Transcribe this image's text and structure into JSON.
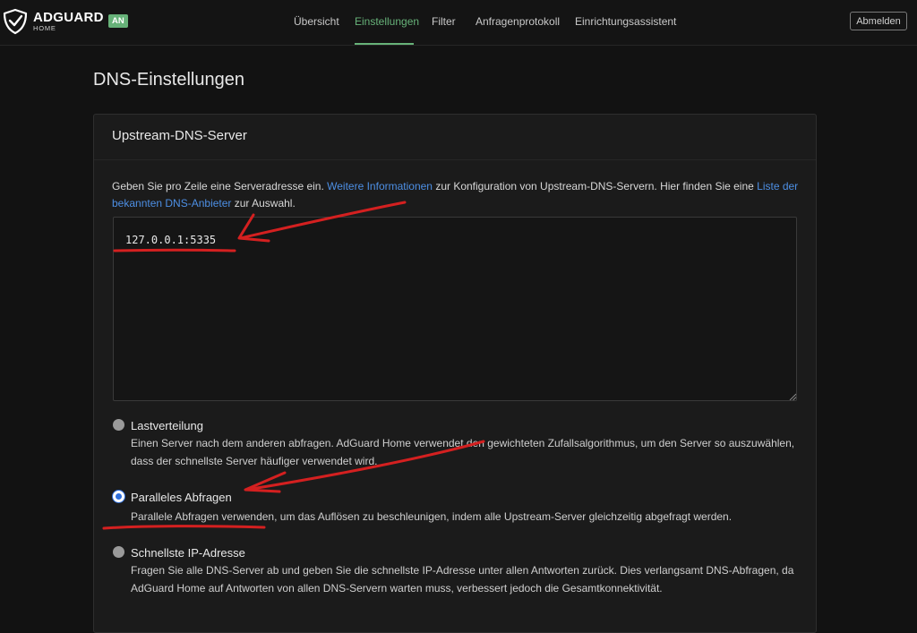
{
  "header": {
    "brand": "ADGUARD",
    "brand_sub": "HOME",
    "status_badge": "AN",
    "nav": [
      {
        "label": "Übersicht",
        "active": false
      },
      {
        "label": "Einstellungen",
        "active": true
      },
      {
        "label": "Filter",
        "active": false
      },
      {
        "label": "Anfragenprotokoll",
        "active": false
      },
      {
        "label": "Einrichtungsassistent",
        "active": false
      }
    ],
    "logout": "Abmelden"
  },
  "page": {
    "title": "DNS-Einstellungen"
  },
  "upstream": {
    "title": "Upstream-DNS-Server",
    "desc_1": "Geben Sie pro Zeile eine Serveradresse ein. ",
    "desc_link_1": "Weitere Informationen",
    "desc_2": " zur Konfiguration von Upstream-DNS-Servern. Hier finden Sie eine ",
    "desc_link_2": "Liste der bekannten DNS-Anbieter",
    "desc_3": " zur Auswahl.",
    "servers_value": "127.0.0.1:5335",
    "modes": [
      {
        "label": "Lastverteilung",
        "description": "Einen Server nach dem anderen abfragen. AdGuard Home verwendet den gewichteten Zufallsalgorithmus, um den Server so auszuwählen, dass der schnellste Server häufiger verwendet wird.",
        "selected": false
      },
      {
        "label": "Paralleles Abfragen",
        "description": "Parallele Abfragen verwenden, um das Auflösen zu beschleunigen, indem alle Upstream-Server gleichzeitig abgefragt werden.",
        "selected": true
      },
      {
        "label": "Schnellste IP-Adresse",
        "description": "Fragen Sie alle DNS-Server ab und geben Sie die schnellste IP-Adresse unter allen Antworten zurück. Dies verlangsamt DNS-Abfragen, da AdGuard Home auf Antworten von allen DNS-Servern warten muss, verbessert jedoch die Gesamtkonnektivität.",
        "selected": false
      }
    ]
  },
  "colors": {
    "background": "#121212",
    "card": "#1b1b1b",
    "accent": "#67b279",
    "link": "#4d8fe4",
    "radio_checked": "#2f6fdc",
    "annotation": "#d42020"
  },
  "icons": {
    "logo": "adguard-shield-check-icon",
    "resize": "resize-grip-icon"
  }
}
